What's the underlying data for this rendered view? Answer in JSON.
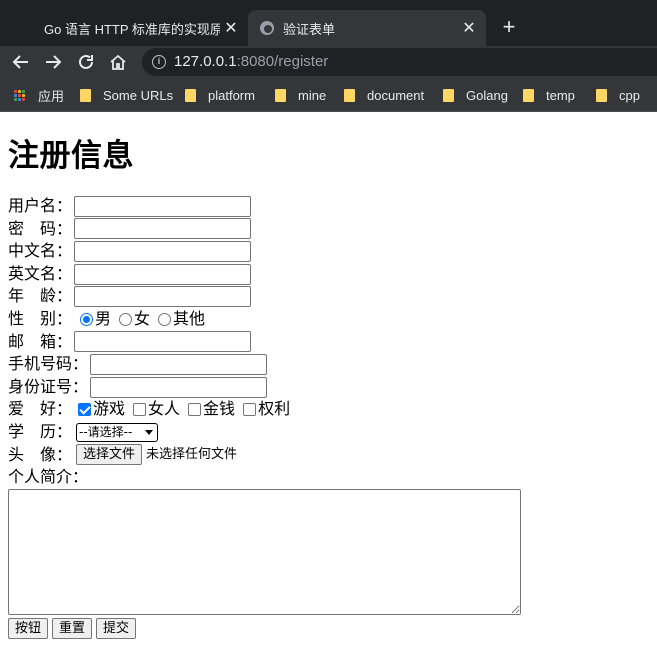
{
  "browser": {
    "tabs": [
      {
        "title": "Go 语言 HTTP 标准库的实现原理",
        "active": false
      },
      {
        "title": "验证表单",
        "active": true
      }
    ],
    "url_host": "127.0.0.1",
    "url_path": ":8080/register",
    "bookmarks": [
      "应用",
      "Some URLs",
      "platform",
      "mine",
      "document",
      "Golang",
      "temp",
      "cpp"
    ]
  },
  "form": {
    "heading": "注册信息",
    "username_label": "用户名：",
    "password_label": "密　码：",
    "chinese_name_label": "中文名：",
    "english_name_label": "英文名：",
    "age_label": "年　龄：",
    "gender_label": "性　别：",
    "gender_options": [
      "男",
      "女",
      "其他"
    ],
    "gender_selected": "男",
    "email_label": "邮　箱：",
    "phone_label": "手机号码：",
    "id_label": "身份证号：",
    "hobby_label": "爱　好：",
    "hobby_options": [
      "游戏",
      "女人",
      "金钱",
      "权利"
    ],
    "hobby_checked": [
      "游戏"
    ],
    "education_label": "学　历：",
    "education_selected": "--请选择--",
    "avatar_label": "头　像：",
    "file_button": "选择文件",
    "file_status": "未选择任何文件",
    "intro_label": "个人简介：",
    "buttons": [
      "按钮",
      "重置",
      "提交"
    ]
  }
}
